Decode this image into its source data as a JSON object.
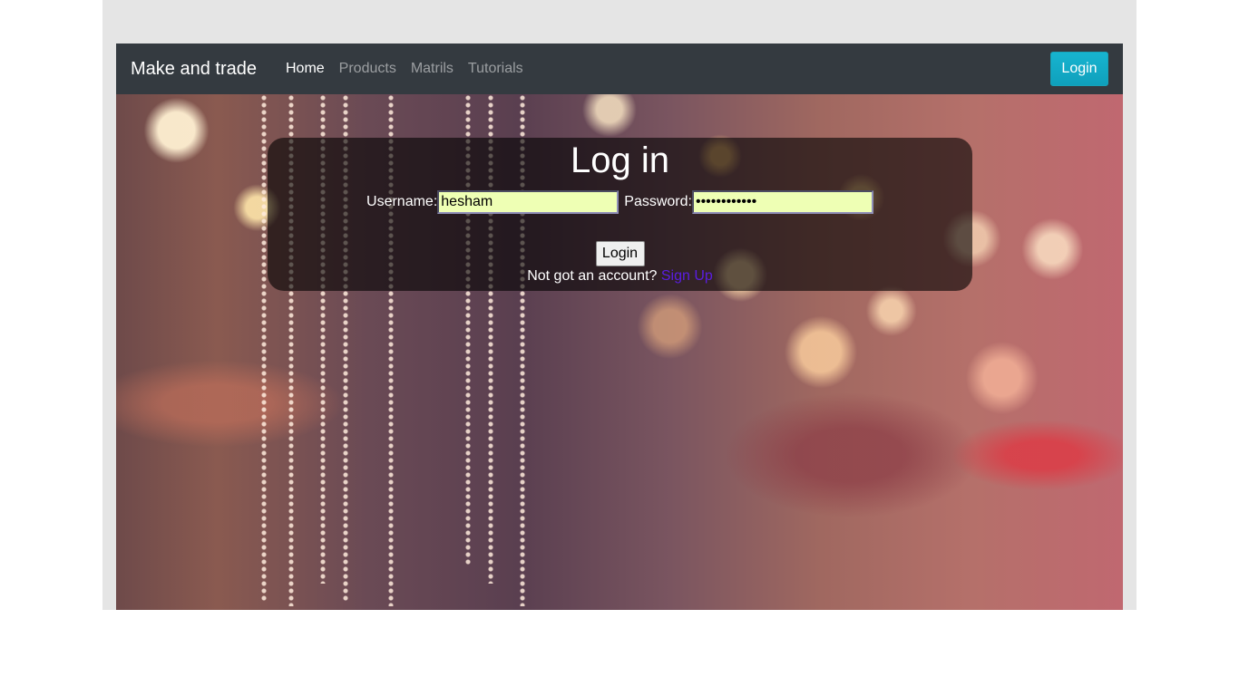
{
  "navbar": {
    "brand": "Make and trade",
    "links": [
      "Home",
      "Products",
      "Matrils",
      "Tutorials"
    ],
    "login_button": "Login"
  },
  "login": {
    "title": "Log in",
    "username_label": "Username:",
    "username_value": "hesham",
    "password_label": "Password:",
    "password_value": "••••••••••••",
    "submit_label": "Login",
    "signup_prompt": "Not got an account?",
    "signup_link": "Sign Up"
  },
  "colors": {
    "navbar_bg": "#343a40",
    "accent_button": "#17a2b8",
    "input_bg": "#eeffb4",
    "signup_link": "#5a1de0"
  }
}
